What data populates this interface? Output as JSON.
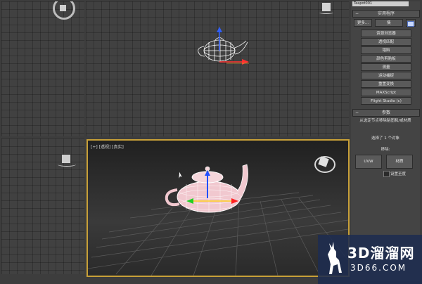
{
  "panel": {
    "object_name": "Teapot001",
    "utilities_header": "实用程序",
    "more_btn": "更多...",
    "sets_btn": "集",
    "utilities": [
      "资源浏览器",
      "透视匹配",
      "塌陷",
      "颜色剪贴板",
      "测量",
      "运动捕捉",
      "重置变换",
      "MAXScript",
      "Flight Studio (c)"
    ],
    "params_header": "参数",
    "params_desc": "从选定节点移除贴图和/或材质",
    "selected_text": "选择了 1 个对象",
    "remove_label": "移除:",
    "uvw_btn": "UVW",
    "material_btn": "材质",
    "set_default": "设置至度"
  },
  "viewports": {
    "persp_label": "[+] [透视] [真实]"
  },
  "watermark": {
    "cn": "3D溜溜网",
    "en": "3D66.COM"
  },
  "colors": {
    "active_border": "#c8a038",
    "x_axis": "#ff2020",
    "y_axis": "#20d020",
    "z_axis": "#2050ff",
    "teapot_pink": "#f1c8cf"
  }
}
